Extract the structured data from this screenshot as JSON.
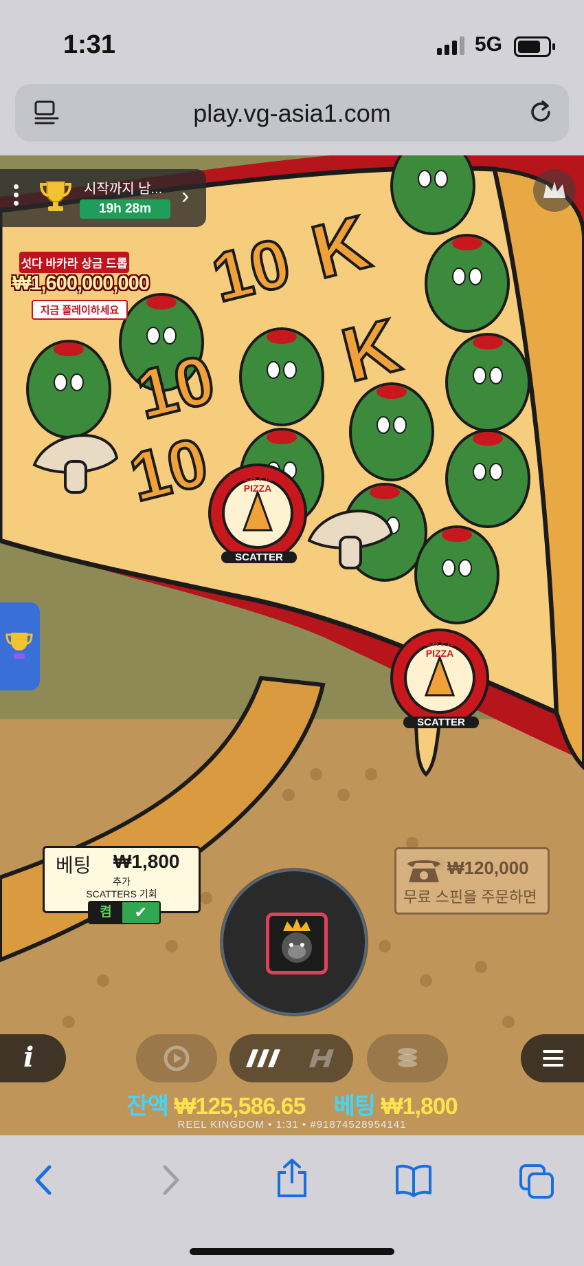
{
  "status_bar": {
    "time": "1:31",
    "network": "5G"
  },
  "browser": {
    "url": "play.vg-asia1.com"
  },
  "tournament": {
    "label": "시작까지 남...",
    "countdown": "19h 28m"
  },
  "promo": {
    "title": "섯다 바카라 상금 드롭",
    "amount": "₩1,600,000,000",
    "cta": "지금 플레이하세요"
  },
  "reels": {
    "symbols_text": [
      "10",
      "10",
      "10",
      "K",
      "K"
    ],
    "scatter_text": "PIZZA PIZZA PIZZA",
    "scatter_label": "SCATTER"
  },
  "bet_panel": {
    "label": "베팅",
    "amount": "₩1,800",
    "extra_line1": "추가",
    "extra_line2": "SCATTERS 기회",
    "toggle_label": "켬"
  },
  "buy_feature": {
    "amount": "₩120,000",
    "text": "무료 스핀을 주문하면"
  },
  "footer": {
    "balance_label": "잔액",
    "balance_value": "₩125,586.65",
    "bet_label": "베팅",
    "bet_value": "₩1,800",
    "build_info": "REEL KINGDOM • 1:31 • #91874528954141"
  },
  "colors": {
    "pizza_crust": "#e7a23a",
    "olive_green": "#3c8a3c",
    "sauce_red": "#c9171e",
    "balance_cyan": "#3fd6ff",
    "balance_yellow": "#ffe34d",
    "spin_ring": "#e0405a"
  },
  "icons": {
    "menu": "hamburger-icon",
    "info": "info-icon",
    "turbo": "turbo-icon",
    "autoplay": "autoplay-icon",
    "stake": "coins-icon",
    "trophy": "trophy-icon",
    "phone": "phone-icon",
    "back": "back-icon",
    "forward": "forward-icon",
    "share": "share-icon",
    "bookmarks": "bookmarks-icon",
    "tabs": "tabs-icon"
  }
}
